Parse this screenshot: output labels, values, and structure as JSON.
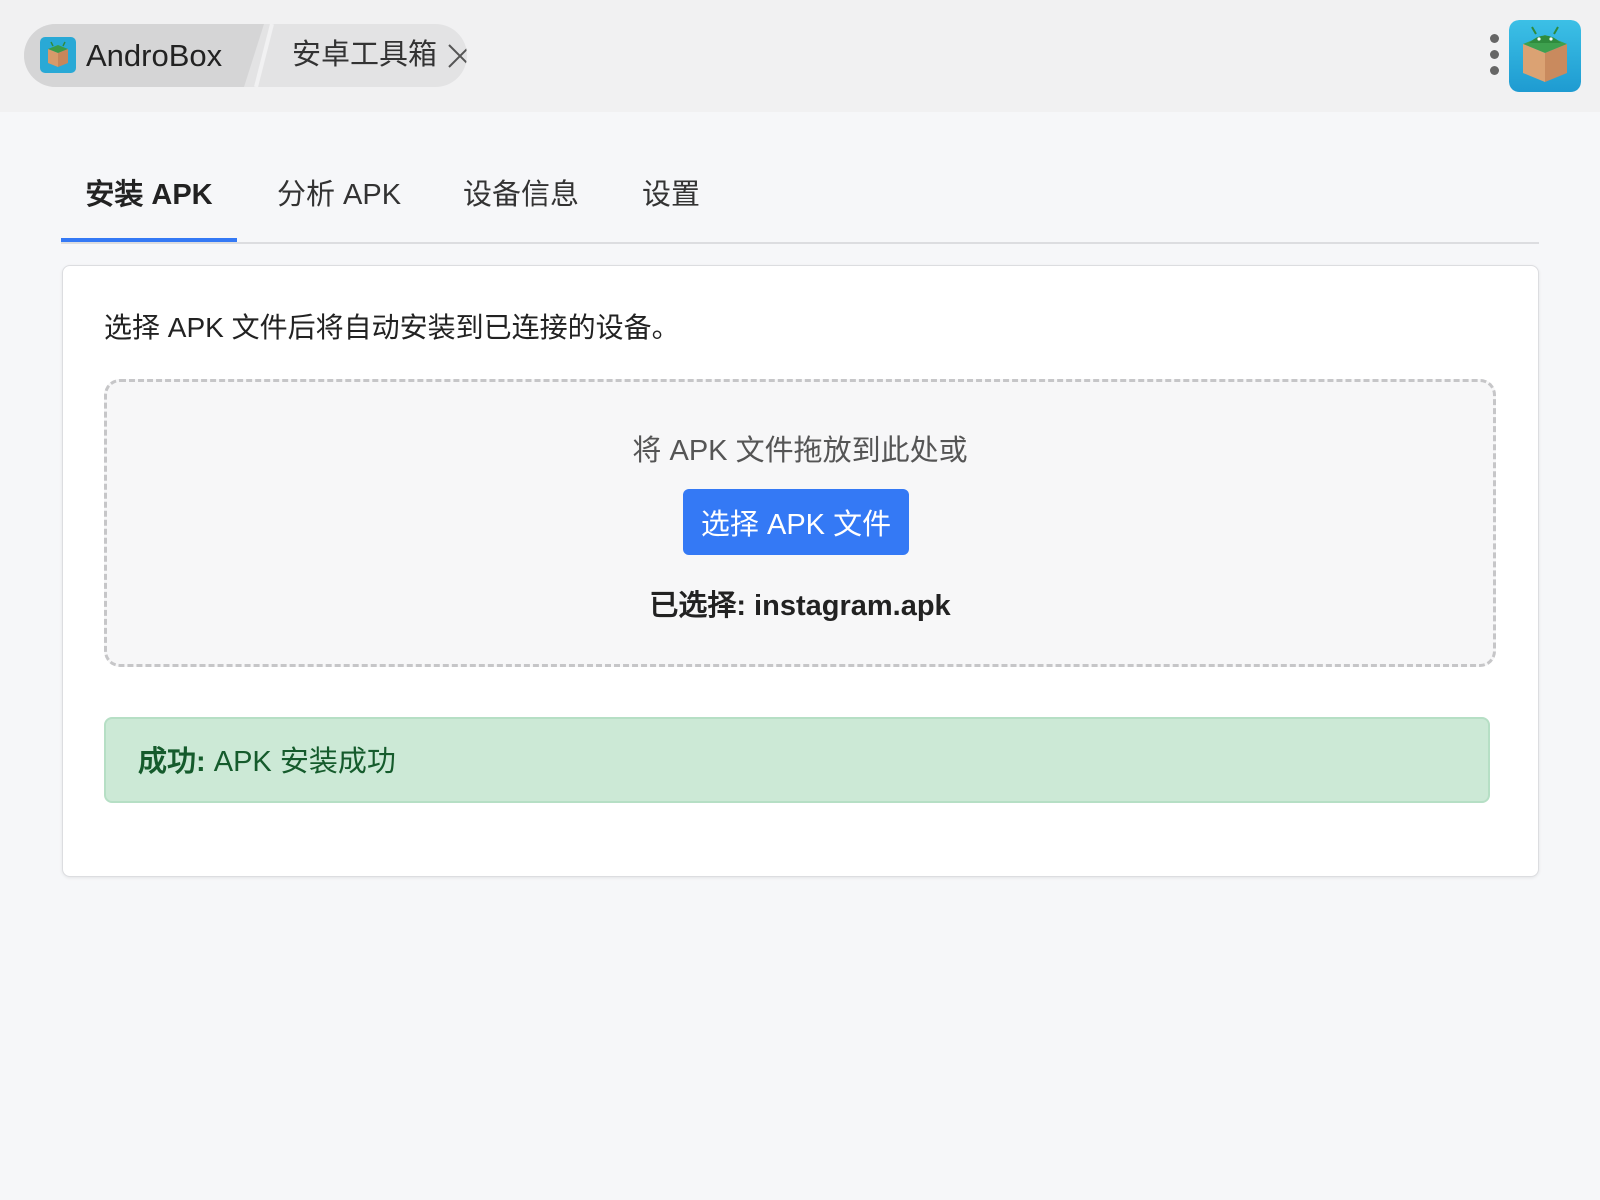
{
  "titlebar": {
    "app_name": "AndroBox",
    "tab_title": "安卓工具箱",
    "icons": {
      "close": "close-icon",
      "menu": "kebab-menu-icon",
      "app": "box-android-icon"
    }
  },
  "tabs": [
    {
      "label": "安装 APK",
      "active": true
    },
    {
      "label": "分析 APK",
      "active": false
    },
    {
      "label": "设备信息",
      "active": false
    },
    {
      "label": "设置",
      "active": false
    }
  ],
  "install": {
    "intro": "选择 APK 文件后将自动安装到已连接的设备。",
    "drop_hint": "将 APK 文件拖放到此处或",
    "choose_button": "选择 APK 文件",
    "selected_label": "已选择:",
    "selected_file": "instagram.apk"
  },
  "alert": {
    "title": "成功:",
    "message": "APK 安装成功"
  },
  "colors": {
    "accent": "#3479f5",
    "success_bg": "#cce9d6",
    "success_text": "#155b2c"
  }
}
